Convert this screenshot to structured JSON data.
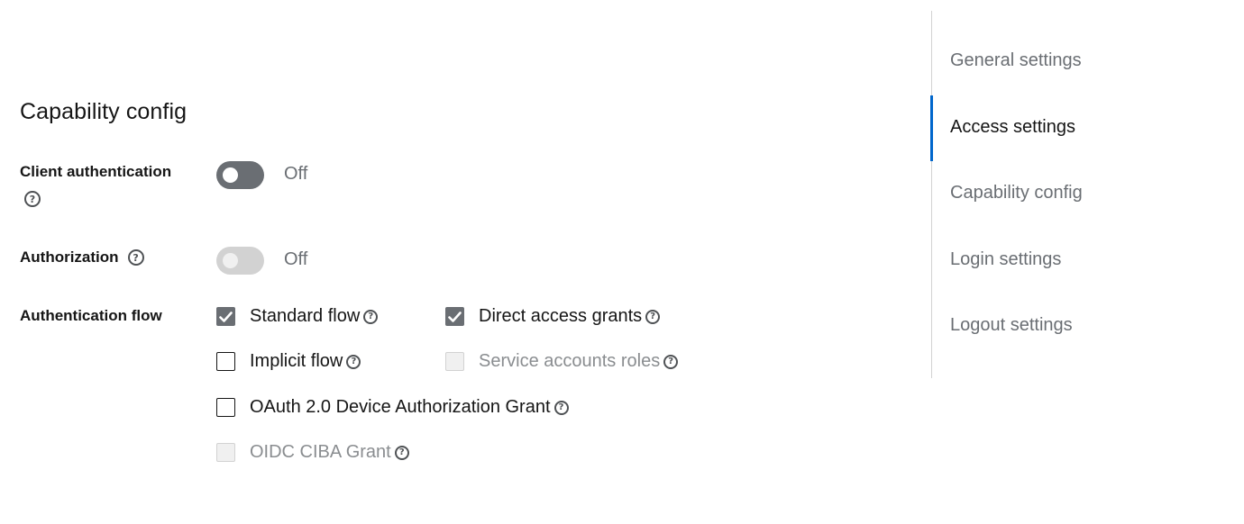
{
  "section": {
    "title": "Capability config"
  },
  "client_authentication": {
    "label": "Client authentication",
    "state_text": "Off",
    "enabled": false
  },
  "authorization": {
    "label": "Authorization",
    "state_text": "Off",
    "enabled": false,
    "disabled": true
  },
  "authentication_flow": {
    "label": "Authentication flow",
    "options": [
      {
        "label": "Standard flow",
        "checked": true,
        "disabled": false
      },
      {
        "label": "Direct access grants",
        "checked": true,
        "disabled": false
      },
      {
        "label": "Implicit flow",
        "checked": false,
        "disabled": false
      },
      {
        "label": "Service accounts roles",
        "checked": false,
        "disabled": true
      },
      {
        "label": "OAuth 2.0 Device Authorization Grant",
        "checked": false,
        "disabled": false
      },
      {
        "label": "OIDC CIBA Grant",
        "checked": false,
        "disabled": true
      }
    ]
  },
  "jump_nav": {
    "items": [
      {
        "label": "General settings",
        "active": false
      },
      {
        "label": "Access settings",
        "active": true
      },
      {
        "label": "Capability config",
        "active": false
      },
      {
        "label": "Login settings",
        "active": false
      },
      {
        "label": "Logout settings",
        "active": false
      }
    ]
  },
  "colors": {
    "accent": "#0066cc",
    "switch_off": "#6a6e73",
    "text_primary": "#151515",
    "text_secondary": "#6a6e73"
  },
  "icons": {
    "help": "question-circle-icon",
    "check": "checkmark-icon"
  }
}
